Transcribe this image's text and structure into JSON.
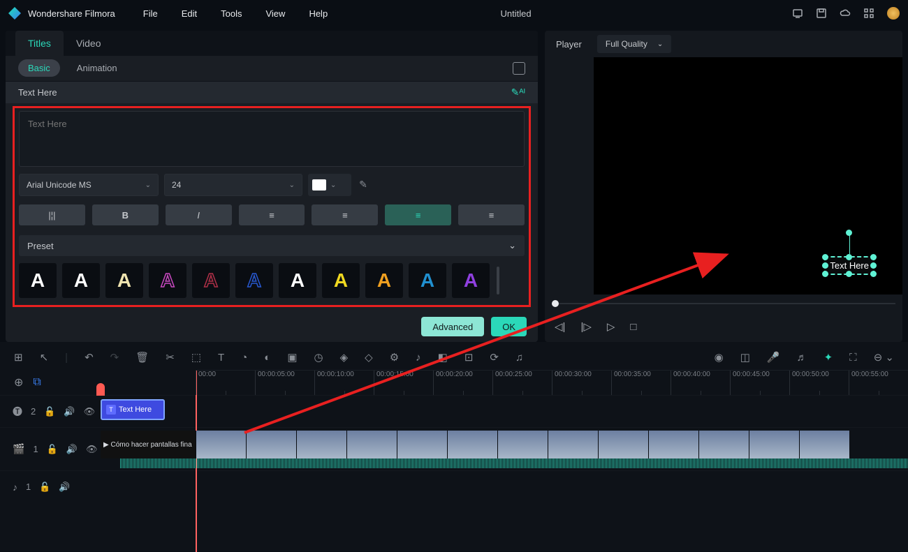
{
  "app": {
    "name": "Wondershare Filmora",
    "doc_title": "Untitled"
  },
  "menu": {
    "file": "File",
    "edit": "Edit",
    "tools": "Tools",
    "view": "View",
    "help": "Help"
  },
  "inspector": {
    "tab_titles": "Titles",
    "tab_video": "Video",
    "sub_basic": "Basic",
    "sub_animation": "Animation",
    "section_label": "Text Here",
    "textarea_placeholder": "Text Here",
    "font": "Arial Unicode MS",
    "size": "24",
    "color": "#ffffff",
    "preset_label": "Preset",
    "btn_advanced": "Advanced",
    "btn_ok": "OK"
  },
  "preset_colors": [
    "#ffffff",
    "#ffffff",
    "#f0e4b0",
    "#c848c0",
    "#b03048",
    "#2858d0",
    "#ffffff",
    "#f0d820",
    "#f0a020",
    "#2090d0",
    "#9040e0"
  ],
  "player": {
    "label": "Player",
    "quality": "Full Quality",
    "overlay_text": "Text Here"
  },
  "timeline": {
    "ticks": [
      "00:00",
      "00:00:05:00",
      "00:00:10:00",
      "00:00:15:00",
      "00:00:20:00",
      "00:00:25:00",
      "00:00:30:00",
      "00:00:35:00",
      "00:00:40:00",
      "00:00:45:00",
      "00:00:50:00",
      "00:00:55:00"
    ],
    "title_track_label": "2",
    "video_track_label": "1",
    "audio_track_label": "1",
    "title_clip_label": "Text Here",
    "video_clip0_label": "▶ Cómo hacer pantallas fina"
  }
}
